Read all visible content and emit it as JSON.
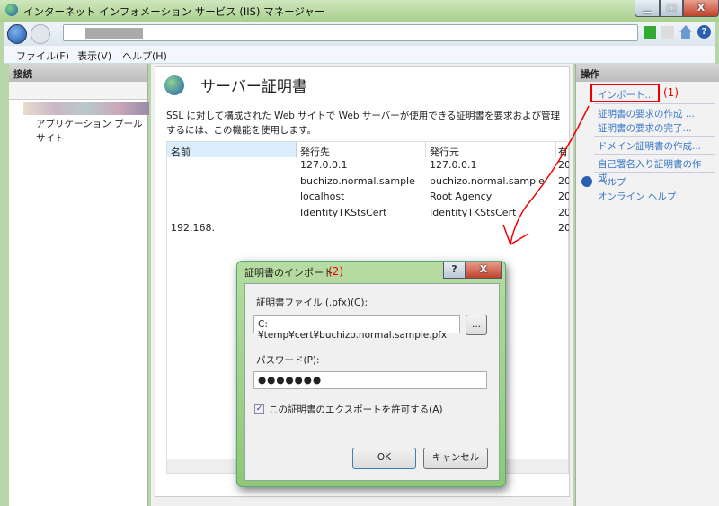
{
  "window": {
    "title": "インターネット インフォメーション サービス (IIS) マネージャー",
    "minimize": "▁",
    "maximize": "□",
    "close": "X"
  },
  "menu": [
    "ファイル(F)",
    "表示(V)",
    "ヘルプ(H)"
  ],
  "left": {
    "header": "接続",
    "tree": [
      "アプリケーション プール",
      "サイト"
    ]
  },
  "center": {
    "title": "サーバー証明書",
    "description": "SSL に対して構成された Web サイトで Web サーバーが使用できる証明書を要求および管理するには、この機能を使用します。",
    "columns": [
      "名前",
      "発行先",
      "発行元",
      "有"
    ],
    "rows": [
      {
        "name": "",
        "issued_to": "127.0.0.1",
        "issued_by": "127.0.0.1",
        "exp": "20"
      },
      {
        "name": "",
        "issued_to": "buchizo.normal.sample",
        "issued_by": "buchizo.normal.sample",
        "exp": "20"
      },
      {
        "name": "",
        "issued_to": "localhost",
        "issued_by": "Root Agency",
        "exp": "20"
      },
      {
        "name": "",
        "issued_to": "IdentityTKStsCert",
        "issued_by": "IdentityTKStsCert",
        "exp": "20"
      },
      {
        "name": "192.168.",
        "issued_to": "",
        "issued_by": "",
        "exp": "20"
      }
    ]
  },
  "right": {
    "header": "操作",
    "actions": [
      "インポート...",
      "証明書の要求の作成 ...",
      "証明書の要求の完了...",
      "ドメイン証明書の作成...",
      "自己署名入り証明書の作成...",
      "ヘルプ",
      "オンライン ヘルプ"
    ]
  },
  "annotations": {
    "one": "(1)",
    "two": "(2)",
    "color": "#e00000"
  },
  "dialog": {
    "title": "証明書のインポート",
    "help": "?",
    "close": "X",
    "file_label": "証明書ファイル (.pfx)(C):",
    "file_value": "C:¥temp¥cert¥buchizo.normal.sample.pfx",
    "browse": "...",
    "password_label": "パスワード(P):",
    "password_value": "●●●●●●●",
    "export_label": "この証明書のエクスポートを許可する(A)",
    "export_checked": true,
    "ok": "OK",
    "cancel": "キャンセル"
  }
}
